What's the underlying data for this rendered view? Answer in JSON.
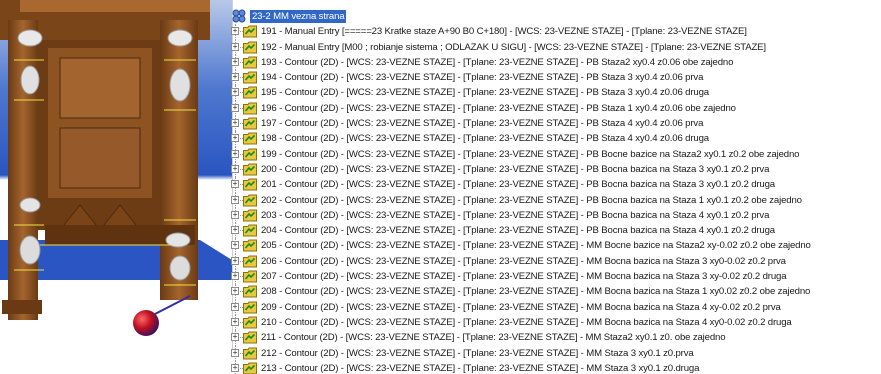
{
  "tree": {
    "root_label": "23-2 MM vezna strana",
    "items": [
      {
        "label": "191 - Manual Entry [=====23 Kratke staze A+90 B0 C+180] - [WCS: 23-VEZNE STAZE] - [Tplane: 23-VEZNE STAZE]"
      },
      {
        "label": "192 - Manual Entry [M00 ; robianje sistema ; ODLAZAK U SIGU] - [WCS: 23-VEZNE STAZE] - [Tplane: 23-VEZNE STAZE]"
      },
      {
        "label": "193 - Contour (2D) - [WCS: 23-VEZNE STAZE] - [Tplane: 23-VEZNE STAZE] - PB Staza2  xy0.4 z0.06 obe zajedno"
      },
      {
        "label": "194 - Contour (2D) - [WCS: 23-VEZNE STAZE] - [Tplane: 23-VEZNE STAZE] - PB Staza 3 xy0.4 z0.06 prva"
      },
      {
        "label": "195 - Contour (2D) - [WCS: 23-VEZNE STAZE] - [Tplane: 23-VEZNE STAZE] - PB Staza 3 xy0.4 z0.06 druga"
      },
      {
        "label": "196 - Contour (2D) - [WCS: 23-VEZNE STAZE] - [Tplane: 23-VEZNE STAZE] - PB Staza 1 xy0.4 z0.06 obe zajedno"
      },
      {
        "label": "197 - Contour (2D) - [WCS: 23-VEZNE STAZE] - [Tplane: 23-VEZNE STAZE] - PB Staza 4 xy0.4 z0.06 prva"
      },
      {
        "label": "198 - Contour (2D) - [WCS: 23-VEZNE STAZE] - [Tplane: 23-VEZNE STAZE] - PB Staza 4 xy0.4 z0.06 druga"
      },
      {
        "label": "199 - Contour (2D) - [WCS: 23-VEZNE STAZE] - [Tplane: 23-VEZNE STAZE] - PB Bocne bazice na Staza2  xy0.1 z0.2 obe zajedno"
      },
      {
        "label": "200 - Contour (2D) - [WCS: 23-VEZNE STAZE] - [Tplane: 23-VEZNE STAZE] - PB Bocna bazica na Staza 3 xy0.1 z0.2 prva"
      },
      {
        "label": "201 - Contour (2D) - [WCS: 23-VEZNE STAZE] - [Tplane: 23-VEZNE STAZE] - PB Bocna bazica na Staza 3 xy0.1 z0.2 druga"
      },
      {
        "label": "202 - Contour (2D) - [WCS: 23-VEZNE STAZE] - [Tplane: 23-VEZNE STAZE] - PB Bocna bazica na Staza 1 xy0.1 z0.2 obe zajedno"
      },
      {
        "label": "203 - Contour (2D) - [WCS: 23-VEZNE STAZE] - [Tplane: 23-VEZNE STAZE] - PB Bocna bazica na Staza 4 xy0.1 z0.2 prva"
      },
      {
        "label": "204 - Contour (2D) - [WCS: 23-VEZNE STAZE] - [Tplane: 23-VEZNE STAZE] - PB Bocna bazica na Staza 4 xy0.1 z0.2 druga"
      },
      {
        "label": "205 - Contour (2D) - [WCS: 23-VEZNE STAZE] - [Tplane: 23-VEZNE STAZE] - MM Bocne bazice na Staza2  xy-0.02 z0.2 obe zajedno"
      },
      {
        "label": "206 - Contour (2D) - [WCS: 23-VEZNE STAZE] - [Tplane: 23-VEZNE STAZE] - MM Bocna bazica na Staza 3 xy0-0.02 z0.2 prva"
      },
      {
        "label": "207 - Contour (2D) - [WCS: 23-VEZNE STAZE] - [Tplane: 23-VEZNE STAZE] - MM Bocna bazica na Staza 3 xy-0.02  z0.2 druga"
      },
      {
        "label": "208 - Contour (2D) - [WCS: 23-VEZNE STAZE] - [Tplane: 23-VEZNE STAZE] - MM Bocna bazica na Staza 1 xy0.02 z0.2 obe zajedno"
      },
      {
        "label": "209 - Contour (2D) - [WCS: 23-VEZNE STAZE] - [Tplane: 23-VEZNE STAZE] - MM Bocna bazica na Staza 4 xy-0.02  z0.2 prva"
      },
      {
        "label": "210 - Contour (2D) - [WCS: 23-VEZNE STAZE] - [Tplane: 23-VEZNE STAZE] - MM Bocna bazica na Staza 4 xy0-0.02 z0.2 druga"
      },
      {
        "label": "211 - Contour (2D) - [WCS: 23-VEZNE STAZE] - [Tplane: 23-VEZNE STAZE] - MM Staza2  xy0.1 z0. obe zajedno"
      },
      {
        "label": "212 - Contour (2D) - [WCS: 23-VEZNE STAZE] - [Tplane: 23-VEZNE STAZE] - MM Staza 3 xy0.1 z0.prva"
      },
      {
        "label": "213 - Contour (2D) - [WCS: 23-VEZNE STAZE] - [Tplane: 23-VEZNE STAZE] - MM Staza 3 xy0.1 z0.druga"
      }
    ],
    "expander_symbol": "+",
    "icons": {
      "root": "operation-group-icon",
      "item": "toolpath-folder-icon"
    }
  },
  "colors": {
    "selection": "#3168c6",
    "viewport_bg": "#2f5cc0",
    "part": "#8a4f1f",
    "part_dark": "#5a3010",
    "part_light": "#b07040",
    "folder": "#e8c840"
  }
}
